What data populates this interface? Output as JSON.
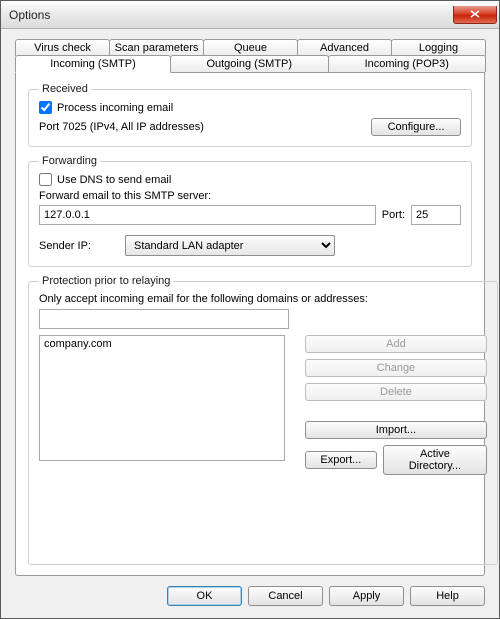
{
  "window": {
    "title": "Options"
  },
  "tabs": {
    "top": [
      "Virus check",
      "Scan parameters",
      "Queue",
      "Advanced",
      "Logging"
    ],
    "bottom": [
      "Incoming (SMTP)",
      "Outgoing (SMTP)",
      "Incoming (POP3)"
    ],
    "active": "Incoming (SMTP)"
  },
  "received": {
    "legend": "Received",
    "process_label": "Process incoming email",
    "process_checked": true,
    "port_text": "Port 7025 (IPv4, All IP addresses)",
    "configure_label": "Configure..."
  },
  "forwarding": {
    "legend": "Forwarding",
    "use_dns_label": "Use DNS to send email",
    "use_dns_checked": false,
    "forward_label": "Forward email to this SMTP server:",
    "server_value": "127.0.0.1",
    "port_label": "Port:",
    "port_value": "25",
    "sender_ip_label": "Sender IP:",
    "sender_ip_value": "Standard LAN adapter"
  },
  "protection": {
    "legend": "Protection prior to relaying",
    "only_accept_label": "Only accept incoming email for the following domains or addresses:",
    "input_value": "",
    "list_item": "company.com",
    "add_label": "Add",
    "change_label": "Change",
    "delete_label": "Delete",
    "import_label": "Import...",
    "export_label": "Export...",
    "ad_label": "Active Directory..."
  },
  "footer": {
    "ok": "OK",
    "cancel": "Cancel",
    "apply": "Apply",
    "help": "Help"
  }
}
